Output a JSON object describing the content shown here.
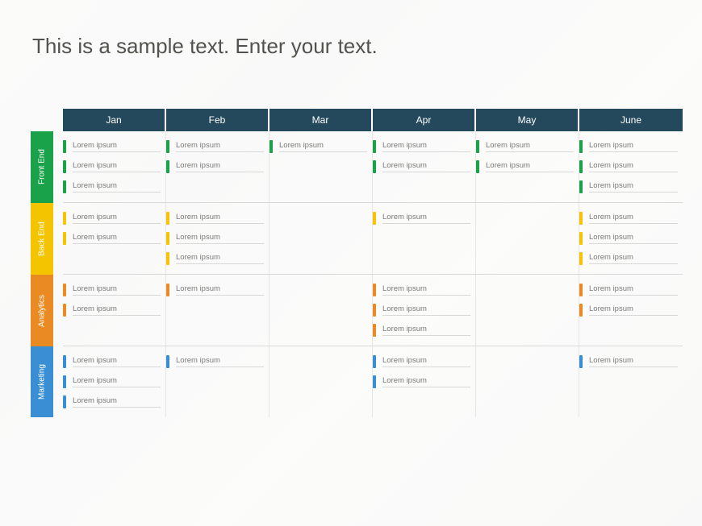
{
  "title": "This is a sample text. Enter your text.",
  "months": [
    "Jan",
    "Feb",
    "Mar",
    "Apr",
    "May",
    "June"
  ],
  "categories": [
    {
      "name": "Front End",
      "color": "#19a24a",
      "tick": "#19a24a",
      "columns": [
        [
          "Lorem ipsum",
          "Lorem ipsum",
          "Lorem ipsum"
        ],
        [
          "Lorem ipsum",
          "Lorem ipsum"
        ],
        [
          "Lorem ipsum"
        ],
        [
          "Lorem ipsum",
          "Lorem ipsum"
        ],
        [
          "Lorem ipsum",
          "Lorem ipsum"
        ],
        [
          "Lorem ipsum",
          "Lorem ipsum",
          "Lorem ipsum"
        ]
      ]
    },
    {
      "name": "Back End",
      "color": "#f5c400",
      "tick": "#f5c400",
      "columns": [
        [
          "Lorem ipsum",
          "Lorem ipsum"
        ],
        [
          "Lorem ipsum",
          "Lorem ipsum",
          "Lorem ipsum"
        ],
        [],
        [
          "Lorem ipsum"
        ],
        [],
        [
          "Lorem ipsum",
          "Lorem ipsum",
          "Lorem ipsum"
        ]
      ]
    },
    {
      "name": "Analytics",
      "color": "#e98b22",
      "tick": "#e98b22",
      "columns": [
        [
          "Lorem ipsum",
          "Lorem ipsum"
        ],
        [
          "Lorem ipsum"
        ],
        [],
        [
          "Lorem ipsum",
          "Lorem ipsum",
          "Lorem ipsum"
        ],
        [],
        [
          "Lorem ipsum",
          "Lorem ipsum"
        ]
      ]
    },
    {
      "name": "Marketing",
      "color": "#3a8fd4",
      "tick": "#3a8fd4",
      "columns": [
        [
          "Lorem ipsum",
          "Lorem ipsum",
          "Lorem ipsum"
        ],
        [
          "Lorem ipsum"
        ],
        [],
        [
          "Lorem ipsum",
          "Lorem ipsum"
        ],
        [],
        [
          "Lorem ipsum"
        ]
      ]
    }
  ]
}
